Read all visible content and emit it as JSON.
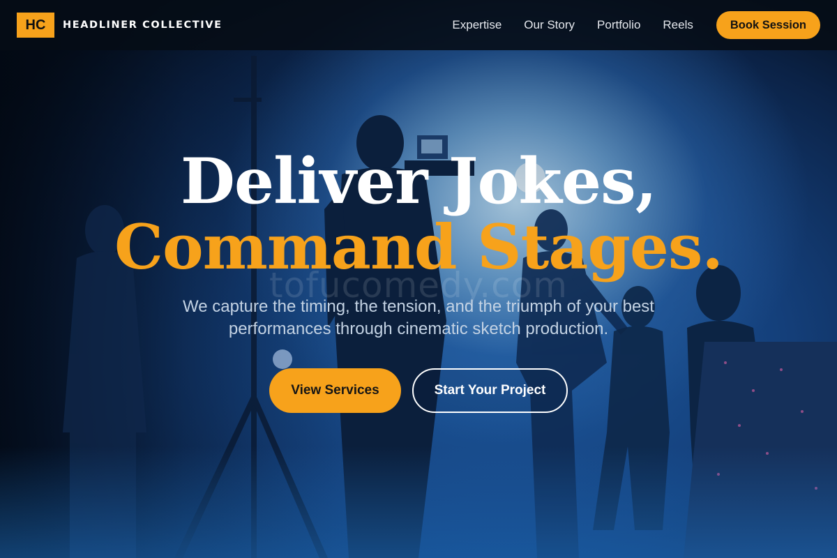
{
  "brand": {
    "badge": "HC",
    "name": "HEADLINER COLLECTIVE"
  },
  "nav": {
    "links": [
      "Expertise",
      "Our Story",
      "Portfolio",
      "Reels"
    ],
    "cta": "Book Session"
  },
  "hero": {
    "headline_line1": "Deliver Jokes,",
    "headline_line2": "Command Stages.",
    "watermark": "tofucomedy.com",
    "subtitle": "We capture the timing, the tension, and the triumph of your best performances through cinematic sketch production.",
    "primary_button": "View Services",
    "secondary_button": "Start Your Project"
  },
  "colors": {
    "accent": "#f7a21b",
    "header_bg": "#060c16",
    "text_light": "#ffffff",
    "subtitle": "#c4d3e4",
    "hero_blue": "#143f7a"
  }
}
